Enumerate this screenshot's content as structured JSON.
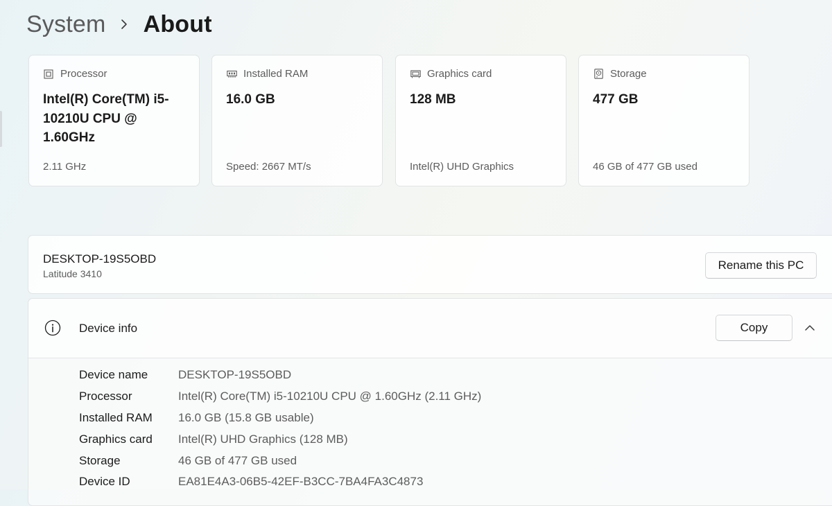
{
  "breadcrumb": {
    "parent": "System",
    "current": "About"
  },
  "cards": [
    {
      "icon": "processor-icon",
      "title": "Processor",
      "value": "Intel(R) Core(TM) i5-10210U CPU @ 1.60GHz",
      "sub": "2.11 GHz"
    },
    {
      "icon": "ram-icon",
      "title": "Installed RAM",
      "value": "16.0 GB",
      "sub": "Speed: 2667 MT/s"
    },
    {
      "icon": "graphics-card-icon",
      "title": "Graphics card",
      "value": "128 MB",
      "sub": "Intel(R) UHD Graphics"
    },
    {
      "icon": "storage-icon",
      "title": "Storage",
      "value": "477 GB",
      "sub": "46 GB of 477 GB used"
    }
  ],
  "pc": {
    "name": "DESKTOP-19S5OBD",
    "model": "Latitude 3410",
    "rename_label": "Rename this PC"
  },
  "device_info": {
    "title": "Device info",
    "copy_label": "Copy",
    "expanded": true,
    "rows": [
      {
        "label": "Device name",
        "value": "DESKTOP-19S5OBD"
      },
      {
        "label": "Processor",
        "value": "Intel(R) Core(TM) i5-10210U CPU @ 1.60GHz (2.11 GHz)"
      },
      {
        "label": "Installed RAM",
        "value": "16.0 GB (15.8 GB usable)"
      },
      {
        "label": "Graphics card",
        "value": "Intel(R) UHD Graphics (128 MB)"
      },
      {
        "label": "Storage",
        "value": "46 GB of 477 GB used"
      },
      {
        "label": "Device ID",
        "value": "EA81E4A3-06B5-42EF-B3CC-7BA4FA3C4873"
      }
    ]
  },
  "colors": {
    "text_primary": "#1b1b1b",
    "text_secondary": "#5c5c5c",
    "card_border": "#e2e4e5"
  }
}
